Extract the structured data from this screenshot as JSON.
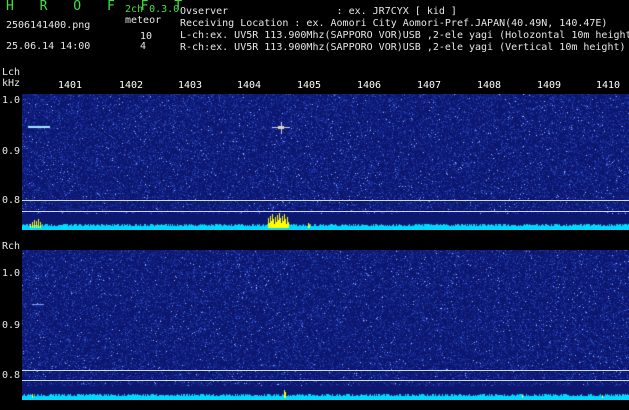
{
  "header": {
    "logo": "H R O F F T",
    "channel_mode": "2ch 0.3.0",
    "filename": "2506141400.png",
    "meteor_label": "meteor",
    "datetime": "25.06.14 14:00",
    "meteor_count_l": "10",
    "meteor_count_r": "4",
    "observer_line": "Ovserver                  : ex. JR7CYX [ kid ]",
    "location_line": "Receiving Location : ex. Aomori City Aomori-Pref.JAPAN(40.49N, 140.47E)",
    "lch_line": "L-ch:ex. UV5R 113.900Mhz(SAPPORO VOR)USB ,2-ele yagi (Holozontal 10m height",
    "rch_line": "R-ch:ex. UV5R 113.900Mhz(SAPPORO VOR)USB ,2-ele yagi (Vertical 10m height)"
  },
  "lch_panel": {
    "channel_label": "Lch",
    "unit_label": "kHz",
    "y_ticks": [
      "1.0",
      "0.9",
      "0.8"
    ],
    "x_ticks": [
      "1401",
      "1402",
      "1403",
      "1404",
      "1405",
      "1406",
      "1407",
      "1408",
      "1409",
      "1410"
    ]
  },
  "rch_panel": {
    "channel_label": "Rch",
    "y_ticks": [
      "1.0",
      "0.9",
      "0.8"
    ]
  },
  "colors": {
    "background": "#000000",
    "spectrum_bg": "#0c1870",
    "noise_floor": "#00d8ff",
    "meteor_echo": "#ffff00",
    "label_green": "#3fe03f",
    "label_white": "#e6e6e6"
  }
}
